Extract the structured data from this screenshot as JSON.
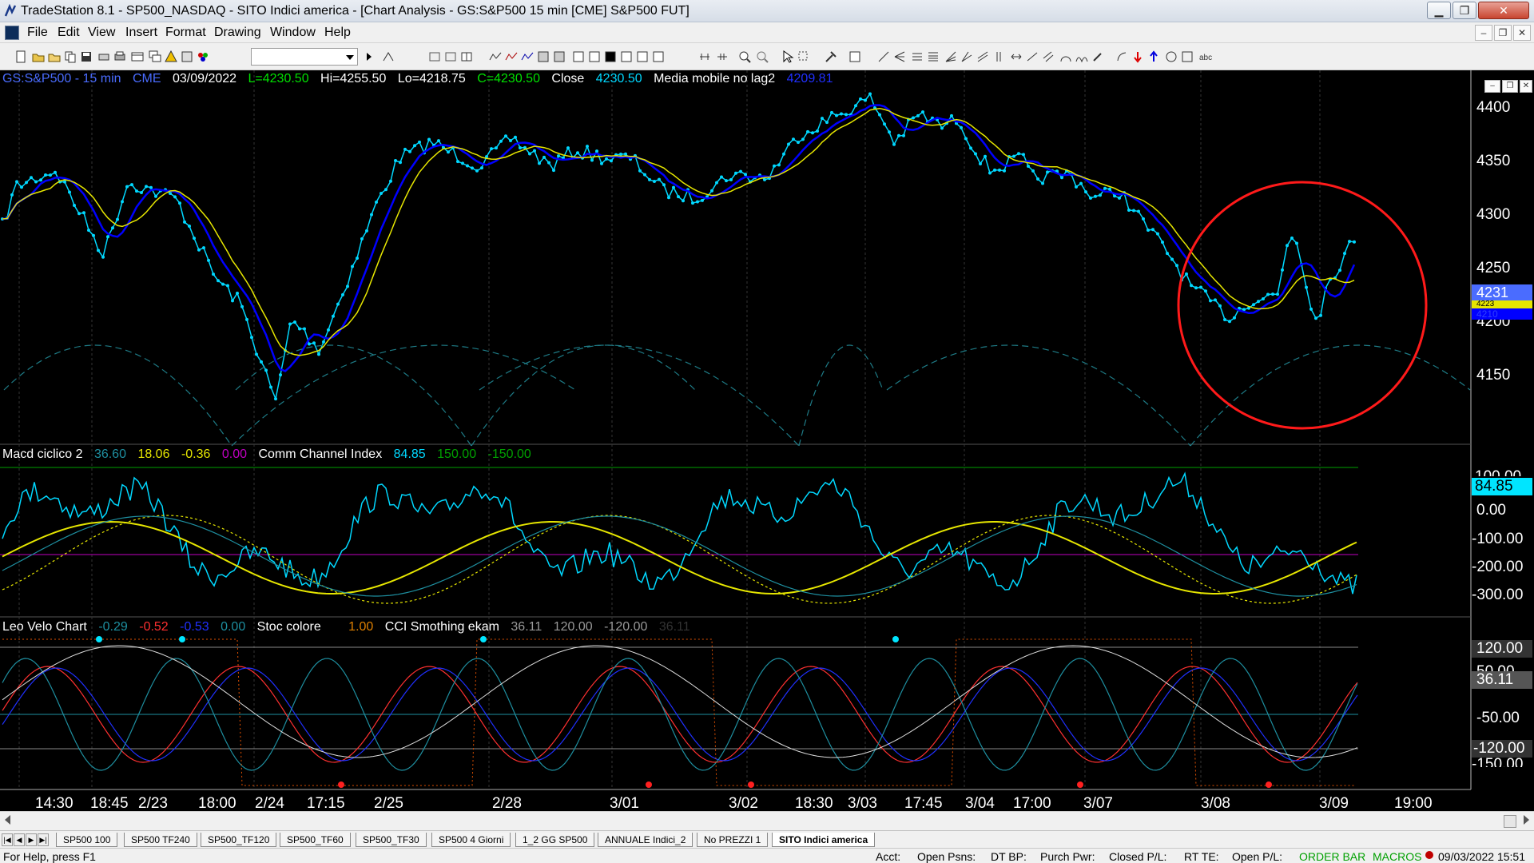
{
  "window": {
    "title": "TradeStation 8.1 - SP500_NASDAQ - SITO Indici america - [Chart Analysis - GS:S&P500  15 min  [CME] S&P500 FUT]",
    "buttons": {
      "minimize": "▁",
      "maximize": "❐",
      "close": "✕"
    }
  },
  "menu": {
    "items": [
      "File",
      "Edit",
      "View",
      "Insert",
      "Format",
      "Drawing",
      "Window",
      "Help"
    ],
    "mdi": {
      "minimize": "–",
      "restore": "❐",
      "close": "✕"
    }
  },
  "chart": {
    "header": {
      "symbol": "GS:S&P500 - 15 min",
      "exchange": "CME",
      "date": "03/09/2022",
      "last": "L=4230.50",
      "high": "Hi=4255.50",
      "low": "Lo=4218.75",
      "close_val": "C=4230.50",
      "close_label": "Close",
      "close_num": "4230.50",
      "ma_label": "Media mobile no lag2",
      "ma_value": "4209.81"
    },
    "subpanel1": {
      "name": "Macd ciclico 2",
      "v1": "36.60",
      "v2": "18.06",
      "v3": "-0.36",
      "v4": "0.00",
      "cci_name": "Comm Channel Index",
      "cci_val": "84.85",
      "cci_hi": "150.00",
      "cci_lo": "-150.00"
    },
    "subpanel2": {
      "name": "Leo Velo Chart",
      "v1": "-0.29",
      "v2": "-0.52",
      "v3": "-0.53",
      "v4": "0.00",
      "stoc_name": "Stoc colore",
      "stoc_val": "1.00",
      "cci2_name": "CCI Smothing ekam",
      "c1": "36.11",
      "c2": "120.00",
      "c3": "-120.00",
      "c4": "36.11"
    },
    "price_axis": [
      "4400",
      "4350",
      "4300",
      "4250",
      "4200",
      "4150"
    ],
    "price_tags": {
      "last": "4231",
      "ma1": "4223",
      "ma2": "4210"
    },
    "cci_axis": [
      "100.00",
      "84.85",
      "0.00",
      "-100.00",
      "-200.00",
      "-300.00"
    ],
    "osc_axis": [
      "120.00",
      "50.00",
      "36.11",
      "-50.00",
      "-120.00",
      "-150.00"
    ],
    "time_axis": [
      "14:30",
      "18:45",
      "2/23",
      "18:00",
      "2/24",
      "17:15",
      "2/25",
      "2/28",
      "3/01",
      "3/02",
      "18:30",
      "3/03",
      "17:45",
      "3/04",
      "17:00",
      "3/07",
      "3/08",
      "3/09",
      "19:00"
    ],
    "colors": {
      "price": "#00d8ff",
      "ma_blue": "#0000ff",
      "ma_yellow": "#e6e600",
      "circle": "#ff1a1a",
      "cycle": "#1e7b86"
    }
  },
  "tabs": [
    "SP500 100",
    "SP500 TF240",
    "SP500_TF120",
    "SP500_TF60",
    "SP500_TF30",
    "SP500 4 Giorni",
    "1_2 GG SP500",
    "ANNUALE Indici_2",
    "No PREZZI 1",
    "SITO Indici america"
  ],
  "status": {
    "help": "For Help, press F1",
    "acct": "Acct:",
    "open_psns": "Open Psns:",
    "dt_bp": "DT BP:",
    "purch_pwr": "Purch Pwr:",
    "closed_pl": "Closed P/L:",
    "rt_te": "RT TE:",
    "open_pl": "Open P/L:",
    "order_bar": "ORDER BAR",
    "macros": "MACROS",
    "datetime": "09/03/2022 15:51"
  }
}
